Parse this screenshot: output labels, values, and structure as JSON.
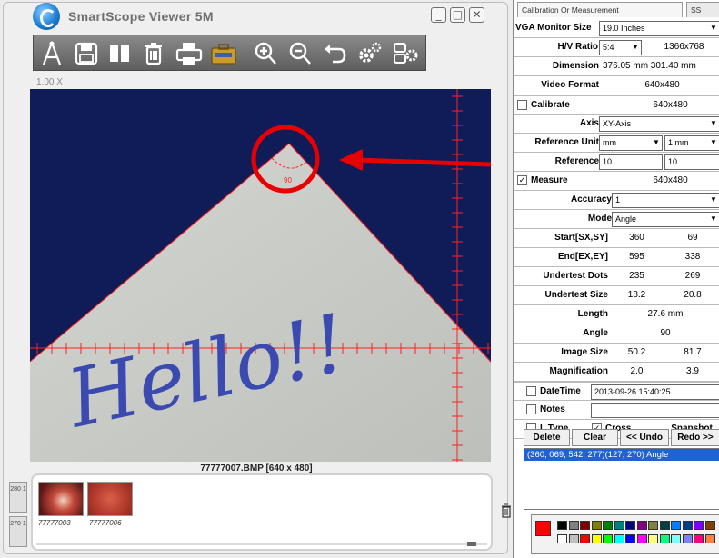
{
  "window": {
    "title": "SmartScope Viewer 5M",
    "minimize_glyph": "_",
    "maximize_glyph": "□",
    "close_glyph": "✕"
  },
  "toolbar": {
    "tools": [
      {
        "icon": "measure-icon"
      },
      {
        "icon": "save-icon"
      },
      {
        "icon": "copy-icon"
      },
      {
        "icon": "delete-icon"
      },
      {
        "icon": "print-icon"
      },
      {
        "icon": "briefcase-icon"
      },
      {
        "icon": "zoom-in-icon"
      },
      {
        "icon": "zoom-out-icon"
      },
      {
        "icon": "undo-icon"
      },
      {
        "icon": "settings-icon"
      },
      {
        "icon": "camera-settings-icon"
      }
    ]
  },
  "viewer": {
    "zoom": "1.00 X",
    "filename": "77777007.BMP [640 x 480]",
    "image_text": "Hello!!",
    "angle_mark": "90",
    "measure_color": "#ff2020",
    "annotation_color": "#e80000"
  },
  "thumbnails": {
    "side_tabs": [
      "280 1",
      "270 1"
    ],
    "items": [
      {
        "label": "77777003"
      },
      {
        "label": "77777006"
      }
    ]
  },
  "panel": {
    "tabs": [
      "Calibration Or Measurement",
      "SS"
    ],
    "monitor": {
      "label": "VGA Monitor Size",
      "value": "19.0 Inches",
      "ratio_label": "H/V Ratio",
      "ratio_value": "5:4",
      "resolution": "1366x768",
      "dimension_label": "Dimension",
      "dimension_value": "376.05 mm  301.40 mm",
      "video_label": "Video Format",
      "video_value": "640x480"
    },
    "calibrate": {
      "label": "Calibrate",
      "checked": false,
      "resolution": "640x480",
      "axis_label": "Axis",
      "axis_value": "XY-Axis",
      "ref_unit_label": "Reference Unit",
      "ref_unit_value": "mm",
      "ref_unit_step": "1 mm",
      "reference_label": "Reference",
      "reference_value_1": "10",
      "reference_value_2": "10"
    },
    "measure": {
      "label": "Measure",
      "checked": true,
      "resolution": "640x480",
      "accuracy_label": "Accuracy",
      "accuracy_value": "1",
      "mode_label": "Mode",
      "mode_value": "Angle",
      "rows": [
        {
          "label": "Start[SX,SY]",
          "a": "360",
          "b": "69"
        },
        {
          "label": "End[EX,EY]",
          "a": "595",
          "b": "338"
        },
        {
          "label": "Undertest Dots",
          "a": "235",
          "b": "269"
        },
        {
          "label": "Undertest Size",
          "a": "18.2",
          "b": "20.8"
        }
      ],
      "length_label": "Length",
      "length_value": "27.6 mm",
      "angle_label": "Angle",
      "angle_value": "90",
      "image_size_label": "Image Size",
      "image_size_a": "50.2",
      "image_size_b": "81.7",
      "magnification_label": "Magnification",
      "magnification_a": "2.0",
      "magnification_b": "3.9"
    },
    "datetime": {
      "label": "DateTime",
      "checked": false,
      "value": "2013-09-26 15:40:25"
    },
    "notes": {
      "label": "Notes",
      "checked": false,
      "value": ""
    },
    "options": {
      "ltype_label": "L Type",
      "ltype_checked": false,
      "cross_label": "Cross",
      "cross_checked": true,
      "snapshot_label": "Snapshot"
    },
    "actions": {
      "delete": "Delete",
      "clear": "Clear",
      "undo": "<< Undo",
      "redo": "Redo >>"
    },
    "log": [
      "(360, 069, 542, 277)(127, 270) Angle"
    ],
    "palette": {
      "current_color": "#ff0000",
      "colors": [
        "#000000",
        "#808080",
        "#800000",
        "#808000",
        "#008000",
        "#008080",
        "#000080",
        "#800080",
        "#808040",
        "#004040",
        "#0080ff",
        "#004080",
        "#8000ff",
        "#804000",
        "#ffffff",
        "#c0c0c0",
        "#ff0000",
        "#ffff00",
        "#00ff00",
        "#00ffff",
        "#0000ff",
        "#ff00ff",
        "#ffff80",
        "#00ff80",
        "#80ffff",
        "#8080ff",
        "#ff0080",
        "#ff8040"
      ]
    }
  }
}
